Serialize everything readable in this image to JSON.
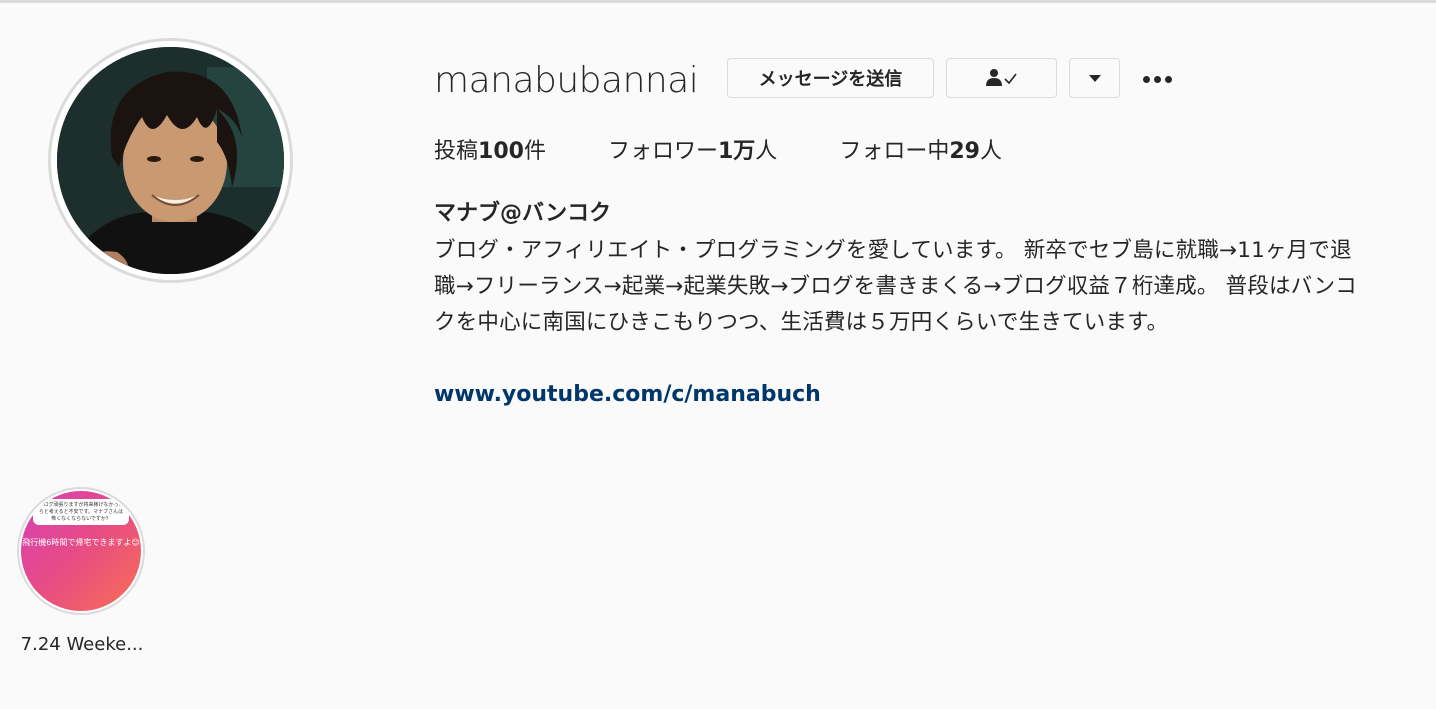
{
  "profile": {
    "username": "manabubannai",
    "message_button": "メッセージを送信",
    "follow_icon": "person-check-icon",
    "dropdown_icon": "triangle-down-icon",
    "more_icon": "ellipsis-icon"
  },
  "stats": {
    "posts_prefix": "投稿",
    "posts_value": "100",
    "posts_suffix": "件",
    "followers_prefix": "フォロワー",
    "followers_value": "1万",
    "followers_suffix": "人",
    "following_prefix": "フォロー中",
    "following_value": "29",
    "following_suffix": "人"
  },
  "bio": {
    "full_name": "マナブ@バンコク",
    "text": "ブログ・アフィリエイト・プログラミングを愛しています。 新卒でセブ島に就職→11ヶ月で退職→フリーランス→起業→起業失敗→ブログを書きまくる→ブログ収益７桁達成。 普段はバンコクを中心に南国にひきこもりつつ、生活費は５万円くらいで生きています。",
    "link": "www.youtube.com/c/manabuch"
  },
  "highlights": [
    {
      "label": "7.24 Weeke...",
      "card_text": "ブログ頑張りますが将来稼げなかったらと考えると不安です。マナブさんは怖くなくならないですか？",
      "overlay_text": "飛行機6時間で帰宅できますよ😊"
    }
  ],
  "colors": {
    "background": "#fafafa",
    "text": "#262626",
    "link": "#00376b",
    "border": "#dbdbdb"
  }
}
